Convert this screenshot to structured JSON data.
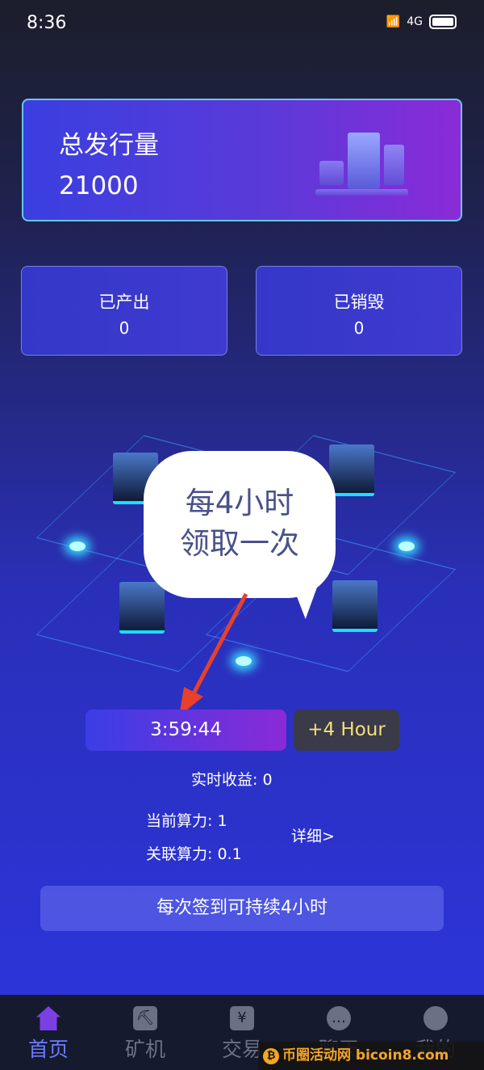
{
  "status_bar": {
    "time": "8:36",
    "network": "4G",
    "icons": [
      "wifi-icon",
      "signal-icon",
      "battery-icon"
    ]
  },
  "supply_card": {
    "title": "总发行量",
    "value": "21000"
  },
  "produced": {
    "title": "已产出",
    "value": "0"
  },
  "destroyed": {
    "title": "已销毁",
    "value": "0"
  },
  "annotation": {
    "line1": "每4小时",
    "line2": "领取一次",
    "arrow_color": "#e8402a"
  },
  "mining": {
    "timer": "3:59:44",
    "extend_button": "+4 Hour",
    "realtime_label": "实时收益:",
    "realtime_value": "0",
    "current_label": "当前算力:",
    "current_value": "1",
    "linked_label": "关联算力:",
    "linked_value": "0.1",
    "detail_link": "详细>"
  },
  "signin_button": "每次签到可持续4小时",
  "tabbar": {
    "items": [
      {
        "label": "首页",
        "icon": "home-icon",
        "active": true
      },
      {
        "label": "矿机",
        "icon": "miner-icon"
      },
      {
        "label": "交易",
        "icon": "yen-icon"
      },
      {
        "label": "聊天",
        "icon": "chat-icon"
      },
      {
        "label": "我的",
        "icon": "user-icon"
      }
    ]
  },
  "watermark": "币圈活动网 bicoin8.com",
  "colors": {
    "accent": "#7a40e6",
    "extend_text": "#f2e07a",
    "tab_active": "#6a7cff"
  }
}
